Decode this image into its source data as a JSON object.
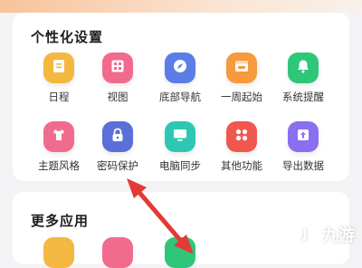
{
  "settings": {
    "title": "个性化设置",
    "row1": [
      {
        "label": "日程",
        "icon": "calendar-list-icon",
        "color": "#f4b740"
      },
      {
        "label": "视图",
        "icon": "grid-view-icon",
        "color": "#f06b8e"
      },
      {
        "label": "底部导航",
        "icon": "compass-icon",
        "color": "#5a7de8"
      },
      {
        "label": "一周起始",
        "icon": "week-start-icon",
        "color": "#f59a3d"
      },
      {
        "label": "系统提醒",
        "icon": "bell-icon",
        "color": "#2ec77a"
      }
    ],
    "row2": [
      {
        "label": "主题风格",
        "icon": "tshirt-icon",
        "color": "#f06b8e"
      },
      {
        "label": "密码保护",
        "icon": "lock-icon",
        "color": "#5a6fd8"
      },
      {
        "label": "电脑同步",
        "icon": "monitor-icon",
        "color": "#2ec7b4"
      },
      {
        "label": "其他功能",
        "icon": "apps-icon",
        "color": "#f0584f"
      },
      {
        "label": "导出数据",
        "icon": "export-icon",
        "color": "#8a6ff0"
      }
    ]
  },
  "more": {
    "title": "更多应用"
  },
  "watermark": {
    "text": "九游",
    "mark": "J"
  },
  "colors": {
    "arrow": "#e53935"
  }
}
